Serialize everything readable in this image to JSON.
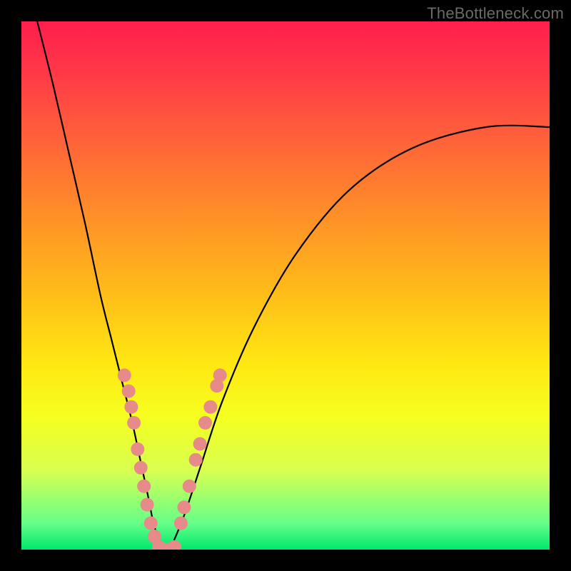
{
  "watermark": "TheBottleneck.com",
  "chart_data": {
    "type": "line",
    "title": "",
    "xlabel": "",
    "ylabel": "",
    "xlim": [
      0,
      100
    ],
    "ylim": [
      0,
      100
    ],
    "grid": false,
    "series": [
      {
        "name": "bottleneck-curve",
        "x": [
          3,
          6,
          9,
          12,
          15,
          17,
          19,
          21,
          22.5,
          24,
          25,
          26,
          27,
          28,
          29,
          31,
          34,
          38,
          44,
          52,
          62,
          74,
          88,
          100
        ],
        "y": [
          100,
          88,
          75,
          62,
          48,
          40,
          32,
          24,
          17,
          10,
          5,
          2,
          0,
          0,
          2,
          7,
          16,
          28,
          42,
          56,
          68,
          76,
          80,
          80
        ],
        "color": "#000000"
      }
    ],
    "marker_clusters": [
      {
        "name": "left-branch-markers",
        "color": "#e68a8a",
        "points": [
          {
            "x": 19.5,
            "y": 33
          },
          {
            "x": 20.3,
            "y": 30
          },
          {
            "x": 20.8,
            "y": 27
          },
          {
            "x": 21.3,
            "y": 24
          },
          {
            "x": 22.0,
            "y": 19
          },
          {
            "x": 22.6,
            "y": 15.5
          },
          {
            "x": 23.2,
            "y": 12
          },
          {
            "x": 23.8,
            "y": 8.5
          },
          {
            "x": 24.5,
            "y": 5
          },
          {
            "x": 25.2,
            "y": 2.5
          }
        ]
      },
      {
        "name": "valley-markers",
        "color": "#e68a8a",
        "points": [
          {
            "x": 26.0,
            "y": 0.5
          },
          {
            "x": 27.0,
            "y": 0
          },
          {
            "x": 28.0,
            "y": 0
          },
          {
            "x": 29.0,
            "y": 0.5
          }
        ]
      },
      {
        "name": "right-branch-markers",
        "color": "#e68a8a",
        "points": [
          {
            "x": 30.2,
            "y": 5
          },
          {
            "x": 30.8,
            "y": 8
          },
          {
            "x": 31.8,
            "y": 12
          },
          {
            "x": 33.0,
            "y": 17
          },
          {
            "x": 33.8,
            "y": 20
          },
          {
            "x": 34.8,
            "y": 24
          },
          {
            "x": 35.8,
            "y": 27
          },
          {
            "x": 37.0,
            "y": 31
          },
          {
            "x": 37.6,
            "y": 33
          }
        ]
      }
    ],
    "background": {
      "gradient_name": "bottleneck-heat",
      "stops": [
        {
          "pos": 0,
          "color": "#ff1e4d"
        },
        {
          "pos": 50,
          "color": "#ffe812"
        },
        {
          "pos": 100,
          "color": "#00e86c"
        }
      ]
    }
  }
}
